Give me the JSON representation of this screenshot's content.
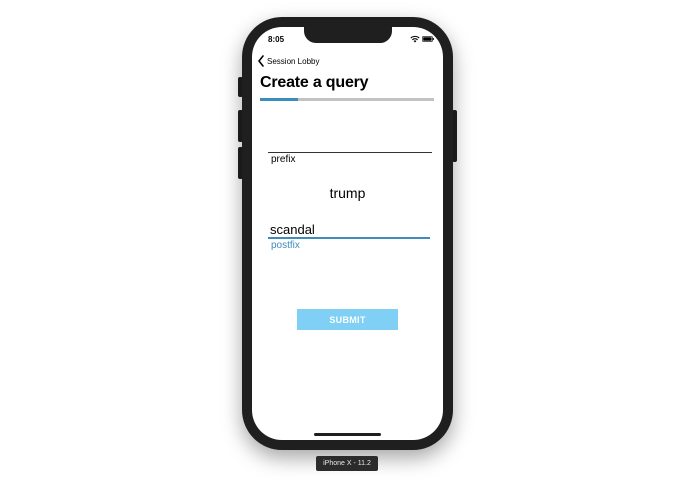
{
  "status_bar": {
    "time": "8:05",
    "wifi_icon": "wifi-icon",
    "battery_icon": "battery-icon"
  },
  "nav": {
    "back_icon": "chevron-left-icon",
    "back_label": "Session Lobby"
  },
  "page": {
    "title": "Create a query",
    "progress": 0.22
  },
  "form": {
    "prefix_value": "",
    "prefix_label": "prefix",
    "term": "trump",
    "postfix_value": "scandal",
    "postfix_label": "postfix",
    "submit_label": "SUBMIT"
  },
  "simulator": {
    "device_label": "iPhone X - 11.2"
  },
  "colors": {
    "accent": "#3c8dbc",
    "submit_bg": "#7fd0f4",
    "progress_track": "#c2c2c2",
    "device_frame": "#1f1f1f"
  }
}
